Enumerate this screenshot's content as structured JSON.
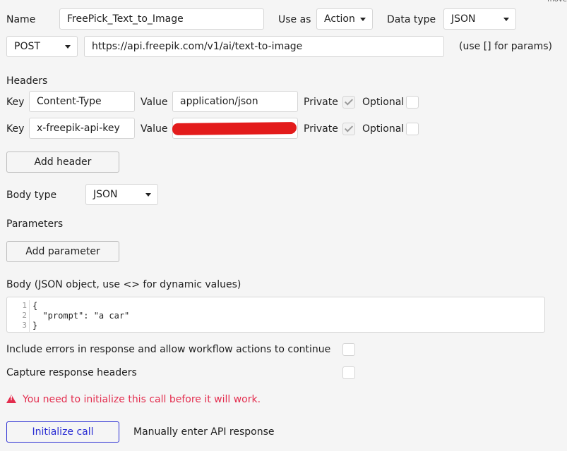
{
  "corner_text": "move",
  "name": {
    "label": "Name",
    "value": "FreePick_Text_to_Image"
  },
  "use_as": {
    "label": "Use as",
    "value": "Action"
  },
  "data_type": {
    "label": "Data type",
    "value": "JSON"
  },
  "method": {
    "value": "POST"
  },
  "url": {
    "value": "https://api.freepik.com/v1/ai/text-to-image",
    "hint": "(use [] for params)"
  },
  "headers": {
    "title": "Headers",
    "key_label": "Key",
    "value_label": "Value",
    "private_label": "Private",
    "optional_label": "Optional",
    "rows": [
      {
        "key": "Content-Type",
        "value": "application/json",
        "private": true,
        "optional": false
      },
      {
        "key": "x-freepik-api-key",
        "value": "",
        "private": true,
        "optional": false
      }
    ],
    "add_label": "Add header"
  },
  "body_type": {
    "label": "Body type",
    "value": "JSON"
  },
  "parameters": {
    "title": "Parameters",
    "add_label": "Add parameter"
  },
  "body": {
    "label": "Body (JSON object, use <> for dynamic values)",
    "lines": [
      {
        "n": "1",
        "text": "{"
      },
      {
        "n": "2",
        "text": "  \"prompt\": \"a car\""
      },
      {
        "n": "3",
        "text": "}"
      }
    ]
  },
  "include_errors": {
    "label": "Include errors in response and allow workflow actions to continue",
    "checked": false
  },
  "capture_headers": {
    "label": "Capture response headers",
    "checked": false
  },
  "warning": {
    "icon": "warning-icon",
    "text": "You need to initialize this call before it will work.",
    "color": "#e32d4e"
  },
  "actions": {
    "initialize_label": "Initialize call",
    "manual_label": "Manually enter API response"
  },
  "colors": {
    "accent": "#2a2dd3",
    "redaction": "#e31b1b"
  }
}
